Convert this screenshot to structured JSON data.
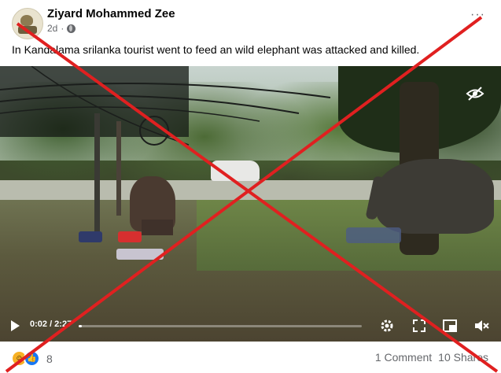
{
  "post": {
    "author": "Ziyard Mohammed Zee",
    "time": "2d",
    "privacy_icon": "globe-icon",
    "menu_label": "···",
    "caption": "In Kandalama srilanka tourist went to feed an wild elephant was attacked and killed."
  },
  "video": {
    "time_display": "0:02 / 2:27",
    "progress": 0.01,
    "icons": [
      "play-icon",
      "eye-off-icon",
      "settings-icon",
      "fullscreen-icon",
      "pip-icon",
      "volume-muted-icon"
    ]
  },
  "footer": {
    "reaction_count": "8",
    "comments": "1 Comment",
    "shares": "10 Shares"
  },
  "colors": {
    "cross": "#e02020",
    "text": "#050505",
    "muted": "#65676b",
    "like": "#1877f2",
    "haha": "#f7b125"
  }
}
